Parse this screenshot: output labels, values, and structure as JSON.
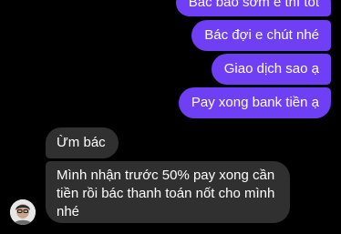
{
  "messages": {
    "outgoing": [
      "Bác báo sớm e thì tốt",
      "Bác đợi e chút nhé",
      "Giao dịch sao ạ",
      "Pay xong bank tiền ạ"
    ],
    "incoming": [
      "Ừm bác",
      "Mình nhận trước 50% pay xong cần tiền rồi bác thanh toán nốt cho mình nhé"
    ]
  },
  "colors": {
    "background": "#000000",
    "outgoing_bubble": "#6f3ff5",
    "incoming_bubble": "#303030",
    "text": "#ffffff"
  },
  "icons": {
    "avatar": "contact-avatar"
  }
}
